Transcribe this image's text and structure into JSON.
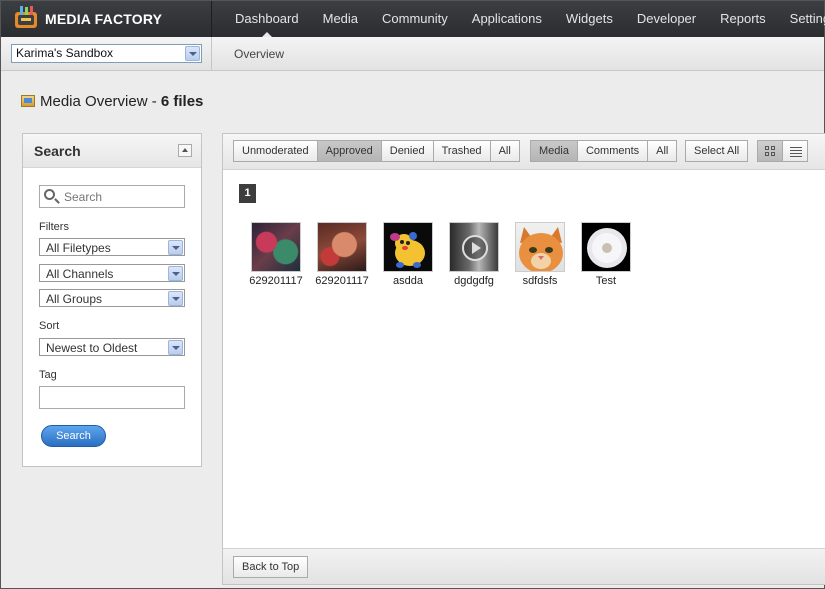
{
  "app": {
    "brand": "MEDIA FACTORY"
  },
  "nav": {
    "items": [
      {
        "label": "Dashboard",
        "active": true
      },
      {
        "label": "Media"
      },
      {
        "label": "Community"
      },
      {
        "label": "Applications"
      },
      {
        "label": "Widgets"
      },
      {
        "label": "Developer"
      },
      {
        "label": "Reports"
      },
      {
        "label": "Settings"
      }
    ]
  },
  "subnav": {
    "sandbox_value": "Karima's Sandbox",
    "overview_label": "Overview"
  },
  "page": {
    "title": "Media Overview - ",
    "count": "6 files"
  },
  "search_panel": {
    "title": "Search",
    "search_placeholder": "Search",
    "filters_label": "Filters",
    "filetypes_value": "All Filetypes",
    "channels_value": "All Channels",
    "groups_value": "All Groups",
    "sort_label": "Sort",
    "sort_value": "Newest to Oldest",
    "tag_label": "Tag",
    "tag_value": "",
    "search_button": "Search"
  },
  "toolbar": {
    "status_buttons": [
      "Unmoderated",
      "Approved",
      "Denied",
      "Trashed",
      "All"
    ],
    "status_selected": "Approved",
    "type_buttons": [
      "Media",
      "Comments",
      "All"
    ],
    "type_selected": "Media",
    "select_all": "Select All",
    "view_mode": "grid"
  },
  "gallery": {
    "page_number": "1",
    "items": [
      {
        "caption": "629201117",
        "icon": "photo-thumbnail"
      },
      {
        "caption": "629201117",
        "icon": "photo-thumbnail"
      },
      {
        "caption": "asdda",
        "icon": "cartoon-thumbnail"
      },
      {
        "caption": "dgdgdfg",
        "icon": "video-thumbnail"
      },
      {
        "caption": "sdfdsfs",
        "icon": "kitten-thumbnail"
      },
      {
        "caption": "Test",
        "icon": "dandelion-thumbnail"
      }
    ]
  },
  "footer": {
    "back_to_top": "Back to Top"
  },
  "colors": {
    "topbar": "#2f3134",
    "accent_blue": "#2a6fc2"
  }
}
